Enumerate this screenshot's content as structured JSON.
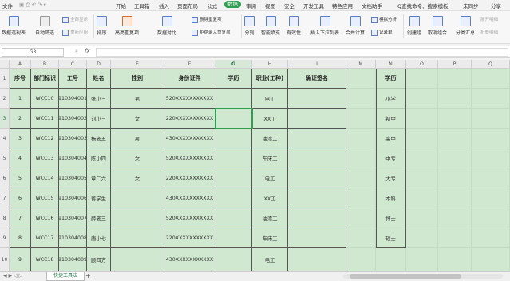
{
  "menubar": {
    "items": [
      "文件",
      "开始",
      "工具箱",
      "插入",
      "页面布局",
      "公式",
      "数据",
      "审阅",
      "视图",
      "安全",
      "开发工具",
      "特色应用",
      "文档助手"
    ],
    "search": "Q查找命令、搜索模板",
    "sync": "未同步",
    "share": "分享"
  },
  "ribbon": {
    "pivot": "数据透视表",
    "autofilter": "自动筛选",
    "showall": "全部显示",
    "reapply": "重新应用",
    "sort": "排序",
    "highlight_dup": "高亮重复项",
    "data_compare": "数据对比",
    "delete_dup": "删除重复项",
    "reject_dup": "拒绝录入重复项",
    "split": "分列",
    "smart_fill": "智能填充",
    "validity": "有效性",
    "dropdown": "插入下拉列表",
    "consolidate": "合并计算",
    "simulate": "模拟分析",
    "record": "记录单",
    "group": "创建组",
    "ungroup": "取消组合",
    "subtotal": "分类汇总",
    "expand": "展开明细",
    "collapse": "折叠明细"
  },
  "formula_bar": {
    "cell_ref": "G3",
    "fx": "fx",
    "value": ""
  },
  "columns": [
    "A",
    "B",
    "C",
    "D",
    "E",
    "F",
    "G",
    "H",
    "I",
    "M",
    "N",
    "O",
    "P",
    "Q"
  ],
  "rows": [
    "1",
    "2",
    "3",
    "4",
    "5",
    "6",
    "7",
    "8",
    "9",
    "10"
  ],
  "table": {
    "headers": [
      "序号",
      "部门标识",
      "工号",
      "姓名",
      "性别",
      "身份证件",
      "学历",
      "职业(工种)",
      "确证签名"
    ],
    "rows": [
      [
        "1",
        "WCC10",
        "910304001",
        "张小三",
        "男",
        "520XXXXXXXXXXX",
        "",
        "电工",
        ""
      ],
      [
        "2",
        "WCC11",
        "910304002",
        "刘小三",
        "女",
        "220XXXXXXXXXXX",
        "",
        "XX工",
        ""
      ],
      [
        "3",
        "WCC12",
        "910304003",
        "杨老五",
        "男",
        "430XXXXXXXXXXX",
        "",
        "油漆工",
        ""
      ],
      [
        "4",
        "WCC13",
        "910304004",
        "陈小四",
        "女",
        "520XXXXXXXXXXX",
        "",
        "车床工",
        ""
      ],
      [
        "5",
        "WCC14",
        "910304005",
        "章二六",
        "女",
        "220XXXXXXXXXXX",
        "",
        "电工",
        ""
      ],
      [
        "6",
        "WCC15",
        "910304006",
        "蒋学生",
        "",
        "430XXXXXXXXXXX",
        "",
        "XX工",
        ""
      ],
      [
        "7",
        "WCC16",
        "910304007",
        "薛老三",
        "",
        "520XXXXXXXXXXX",
        "",
        "油漆工",
        ""
      ],
      [
        "8",
        "WCC17",
        "910304008",
        "唐小七",
        "",
        "220XXXXXXXXXXX",
        "",
        "车床工",
        ""
      ],
      [
        "9",
        "WCC18",
        "910304009",
        "顾四方",
        "",
        "430XXXXXXXXXXX",
        "",
        "电工",
        ""
      ]
    ]
  },
  "education_list": {
    "header": "学历",
    "items": [
      "小学",
      "初中",
      "高中",
      "中专",
      "大专",
      "本科",
      "博士",
      "硕士"
    ]
  },
  "statusbar": {
    "sheet_tab": "快捷工具法",
    "add": "+"
  },
  "colors": {
    "accent": "#2e9e50",
    "sheet_bg": "#cfe8cf"
  }
}
